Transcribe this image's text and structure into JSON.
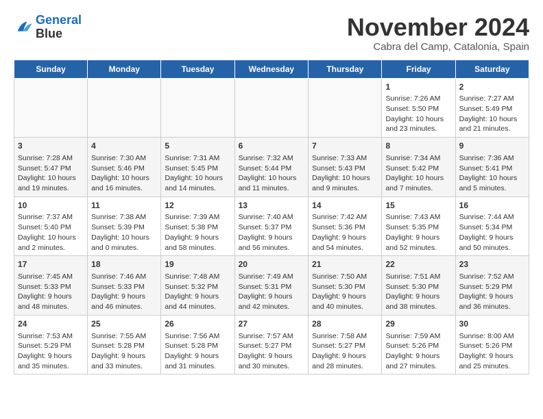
{
  "logo": {
    "line1": "General",
    "line2": "Blue"
  },
  "title": "November 2024",
  "subtitle": "Cabra del Camp, Catalonia, Spain",
  "days_of_week": [
    "Sunday",
    "Monday",
    "Tuesday",
    "Wednesday",
    "Thursday",
    "Friday",
    "Saturday"
  ],
  "weeks": [
    [
      {
        "day": "",
        "info": ""
      },
      {
        "day": "",
        "info": ""
      },
      {
        "day": "",
        "info": ""
      },
      {
        "day": "",
        "info": ""
      },
      {
        "day": "",
        "info": ""
      },
      {
        "day": "1",
        "info": "Sunrise: 7:26 AM\nSunset: 5:50 PM\nDaylight: 10 hours and 23 minutes."
      },
      {
        "day": "2",
        "info": "Sunrise: 7:27 AM\nSunset: 5:49 PM\nDaylight: 10 hours and 21 minutes."
      }
    ],
    [
      {
        "day": "3",
        "info": "Sunrise: 7:28 AM\nSunset: 5:47 PM\nDaylight: 10 hours and 19 minutes."
      },
      {
        "day": "4",
        "info": "Sunrise: 7:30 AM\nSunset: 5:46 PM\nDaylight: 10 hours and 16 minutes."
      },
      {
        "day": "5",
        "info": "Sunrise: 7:31 AM\nSunset: 5:45 PM\nDaylight: 10 hours and 14 minutes."
      },
      {
        "day": "6",
        "info": "Sunrise: 7:32 AM\nSunset: 5:44 PM\nDaylight: 10 hours and 11 minutes."
      },
      {
        "day": "7",
        "info": "Sunrise: 7:33 AM\nSunset: 5:43 PM\nDaylight: 10 hours and 9 minutes."
      },
      {
        "day": "8",
        "info": "Sunrise: 7:34 AM\nSunset: 5:42 PM\nDaylight: 10 hours and 7 minutes."
      },
      {
        "day": "9",
        "info": "Sunrise: 7:36 AM\nSunset: 5:41 PM\nDaylight: 10 hours and 5 minutes."
      }
    ],
    [
      {
        "day": "10",
        "info": "Sunrise: 7:37 AM\nSunset: 5:40 PM\nDaylight: 10 hours and 2 minutes."
      },
      {
        "day": "11",
        "info": "Sunrise: 7:38 AM\nSunset: 5:39 PM\nDaylight: 10 hours and 0 minutes."
      },
      {
        "day": "12",
        "info": "Sunrise: 7:39 AM\nSunset: 5:38 PM\nDaylight: 9 hours and 58 minutes."
      },
      {
        "day": "13",
        "info": "Sunrise: 7:40 AM\nSunset: 5:37 PM\nDaylight: 9 hours and 56 minutes."
      },
      {
        "day": "14",
        "info": "Sunrise: 7:42 AM\nSunset: 5:36 PM\nDaylight: 9 hours and 54 minutes."
      },
      {
        "day": "15",
        "info": "Sunrise: 7:43 AM\nSunset: 5:35 PM\nDaylight: 9 hours and 52 minutes."
      },
      {
        "day": "16",
        "info": "Sunrise: 7:44 AM\nSunset: 5:34 PM\nDaylight: 9 hours and 50 minutes."
      }
    ],
    [
      {
        "day": "17",
        "info": "Sunrise: 7:45 AM\nSunset: 5:33 PM\nDaylight: 9 hours and 48 minutes."
      },
      {
        "day": "18",
        "info": "Sunrise: 7:46 AM\nSunset: 5:33 PM\nDaylight: 9 hours and 46 minutes."
      },
      {
        "day": "19",
        "info": "Sunrise: 7:48 AM\nSunset: 5:32 PM\nDaylight: 9 hours and 44 minutes."
      },
      {
        "day": "20",
        "info": "Sunrise: 7:49 AM\nSunset: 5:31 PM\nDaylight: 9 hours and 42 minutes."
      },
      {
        "day": "21",
        "info": "Sunrise: 7:50 AM\nSunset: 5:30 PM\nDaylight: 9 hours and 40 minutes."
      },
      {
        "day": "22",
        "info": "Sunrise: 7:51 AM\nSunset: 5:30 PM\nDaylight: 9 hours and 38 minutes."
      },
      {
        "day": "23",
        "info": "Sunrise: 7:52 AM\nSunset: 5:29 PM\nDaylight: 9 hours and 36 minutes."
      }
    ],
    [
      {
        "day": "24",
        "info": "Sunrise: 7:53 AM\nSunset: 5:29 PM\nDaylight: 9 hours and 35 minutes."
      },
      {
        "day": "25",
        "info": "Sunrise: 7:55 AM\nSunset: 5:28 PM\nDaylight: 9 hours and 33 minutes."
      },
      {
        "day": "26",
        "info": "Sunrise: 7:56 AM\nSunset: 5:28 PM\nDaylight: 9 hours and 31 minutes."
      },
      {
        "day": "27",
        "info": "Sunrise: 7:57 AM\nSunset: 5:27 PM\nDaylight: 9 hours and 30 minutes."
      },
      {
        "day": "28",
        "info": "Sunrise: 7:58 AM\nSunset: 5:27 PM\nDaylight: 9 hours and 28 minutes."
      },
      {
        "day": "29",
        "info": "Sunrise: 7:59 AM\nSunset: 5:26 PM\nDaylight: 9 hours and 27 minutes."
      },
      {
        "day": "30",
        "info": "Sunrise: 8:00 AM\nSunset: 5:26 PM\nDaylight: 9 hours and 25 minutes."
      }
    ]
  ]
}
